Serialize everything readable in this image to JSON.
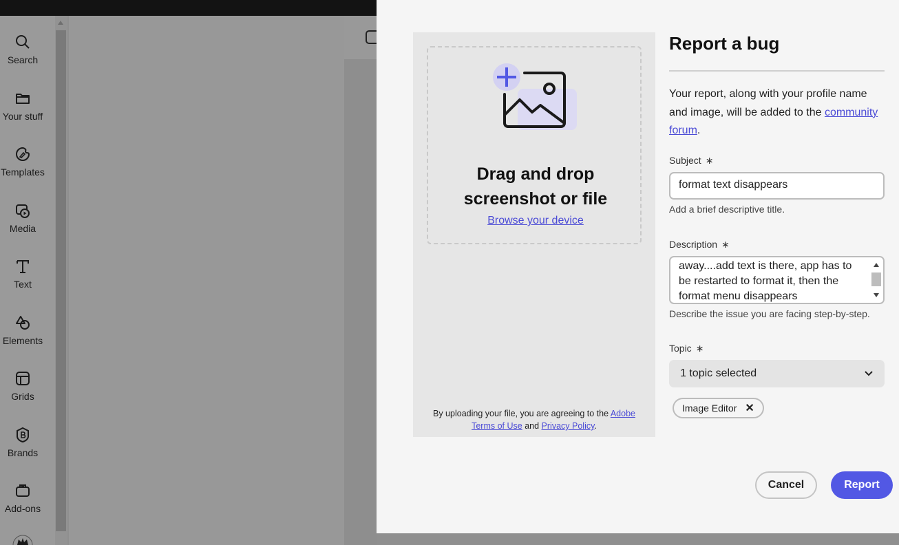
{
  "sidebar": {
    "items": [
      {
        "label": "Search",
        "icon": "search-icon"
      },
      {
        "label": "Your stuff",
        "icon": "folder-icon"
      },
      {
        "label": "Templates",
        "icon": "templates-icon"
      },
      {
        "label": "Media",
        "icon": "media-icon"
      },
      {
        "label": "Text",
        "icon": "text-icon"
      },
      {
        "label": "Elements",
        "icon": "elements-icon"
      },
      {
        "label": "Grids",
        "icon": "grids-icon"
      },
      {
        "label": "Brands",
        "icon": "brands-icon"
      },
      {
        "label": "Add-ons",
        "icon": "add-ons-icon"
      }
    ]
  },
  "upload": {
    "title_line1": "Drag and drop",
    "title_line2": "screenshot or file",
    "browse_label": "Browse your device",
    "legal_prefix": "By uploading your file, you are agreeing to the",
    "terms_link": "Adobe Terms of Use",
    "legal_and": "and",
    "privacy_link": "Privacy Policy",
    "legal_suffix": "."
  },
  "form": {
    "title": "Report a bug",
    "intro_prefix": "Your report, along with your profile name and image, will be added to the",
    "intro_link": "community forum",
    "intro_suffix": ".",
    "subject_label": "Subject",
    "required_mark": "∗",
    "subject_value": "format text disappears",
    "subject_hint": "Add a brief descriptive title.",
    "description_label": "Description",
    "description_value": "away....add text is there, app has to be restarted to format it, then the format menu disappears",
    "description_hint": "Describe the issue you are facing step-by-step.",
    "topic_label": "Topic",
    "topic_value": "1 topic selected",
    "topic_tag": "Image Editor",
    "tag_remove": "✕",
    "cancel_label": "Cancel",
    "report_label": "Report"
  },
  "colors": {
    "accent": "#5258e4",
    "link": "#4b4bd6",
    "overlay": "#8f8f8f"
  }
}
